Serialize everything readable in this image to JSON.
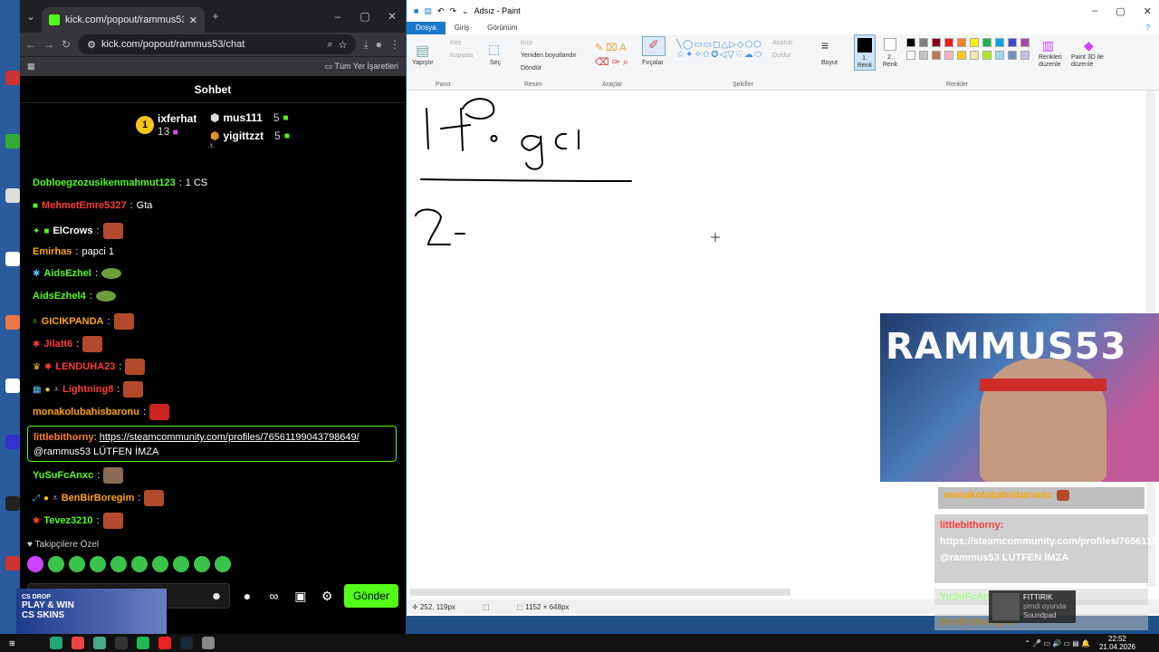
{
  "browser": {
    "tab_title": "kick.com/popout/rammus53/c",
    "url": "kick.com/popout/rammus53/chat",
    "bookmarks_label": "Tüm Yer İşaretleri"
  },
  "chat": {
    "header": "Sohbet",
    "leaderboard": [
      {
        "name": "ixferhat",
        "count": "13"
      },
      {
        "name": "mus111",
        "count": "5"
      },
      {
        "name": "yigittzzt",
        "count": "5"
      }
    ],
    "messages": [
      {
        "user": "Dobloegzozusikenmahmut123",
        "text": "1 CS",
        "color": "#53fc18"
      },
      {
        "user": "MehmetEmre5327",
        "text": "Gta",
        "color": "#ff3b3b"
      },
      {
        "user": "ElCrows",
        "text": "",
        "color": "#fff"
      },
      {
        "user": "Emirhas",
        "text": "papci 1",
        "color": "#ffa500"
      },
      {
        "user": "AidsEzhel",
        "text": "",
        "color": "#53fc18"
      },
      {
        "user": "AidsEzhel4",
        "text": "",
        "color": "#53fc18"
      },
      {
        "user": "GICIKPANDA",
        "text": "",
        "color": "#ffa500"
      },
      {
        "user": "Jilatt6",
        "text": "",
        "color": "#ff3b3b"
      },
      {
        "user": "LENDUHA23",
        "text": "",
        "color": "#ff3b3b"
      },
      {
        "user": "Lightning8",
        "text": "",
        "color": "#ff3b3b"
      },
      {
        "user": "monakolubahisbaronu",
        "text": "",
        "color": "#ffa500"
      },
      {
        "user": "YuSuFcAnxc",
        "text": "",
        "color": "#53fc18"
      },
      {
        "user": "BenBirBoregim",
        "text": "",
        "color": "#ffa500"
      },
      {
        "user": "Tevez3210",
        "text": "",
        "color": "#53fc18"
      }
    ],
    "highlight": {
      "user": "littlebithorny",
      "link": "https://steamcommunity.com/profiles/76561199043798649/",
      "text": "@rammus53 LÜTFEN İMZA"
    },
    "followers_only": "Takipçilere Özel",
    "send_label": "Gönder"
  },
  "ad": {
    "line1": "CS DROP",
    "line2": "PLAY & WIN",
    "line3": "CS SKINS"
  },
  "paint": {
    "title": "Adsız - Paint",
    "tabs": [
      "Dosya",
      "Giriş",
      "Görünüm"
    ],
    "groups": [
      "Pano",
      "Resim",
      "Araçlar",
      "Şekiller",
      "Renkler"
    ],
    "tools": {
      "paste": "Yapıştır",
      "cut": "Kes",
      "copy": "Kopyala",
      "select": "Seç",
      "crop": "Kırp",
      "resize": "Yeniden boyutlandır",
      "rotate": "Döndür",
      "brushes": "Fırçalar",
      "outline": "Anahat",
      "fill": "Doldur",
      "size": "Boyut",
      "color1": "1. Renk",
      "color2": "2. Renk",
      "edit_colors": "Renkleri düzenle",
      "paint3d": "Paint 3D ile düzenle"
    },
    "status_pos": "252, 119px",
    "status_size": "1152 × 648px"
  },
  "overlay": {
    "donor": "monakolubahisbaronu:",
    "msg_user": "littlebithorny:",
    "msg_text": "https://steamcommunity.com/profiles/76561199043798649/ @rammus53 LÜTFEN İMZA",
    "faded1": "YuSuFcAnxc",
    "faded2": "BenBirBoregim:",
    "spotify_title": "FITTIRIK",
    "spotify_sub": "şimdi oyunda",
    "spotify_app": "Soundpad",
    "webcam_brand": "RAMMUS53"
  },
  "taskbar": {
    "time": "22:52",
    "date": "21.04.2026"
  },
  "palette": [
    "#000000",
    "#7f7f7f",
    "#880015",
    "#ed1c24",
    "#ff7f27",
    "#fff200",
    "#22b14c",
    "#00a2e8",
    "#3f48cc",
    "#a349a4",
    "#ffffff",
    "#c3c3c3",
    "#b97a57",
    "#ffaec9",
    "#ffc90e",
    "#efe4b0",
    "#b5e61d",
    "#99d9ea",
    "#7092be",
    "#c8bfe7"
  ]
}
